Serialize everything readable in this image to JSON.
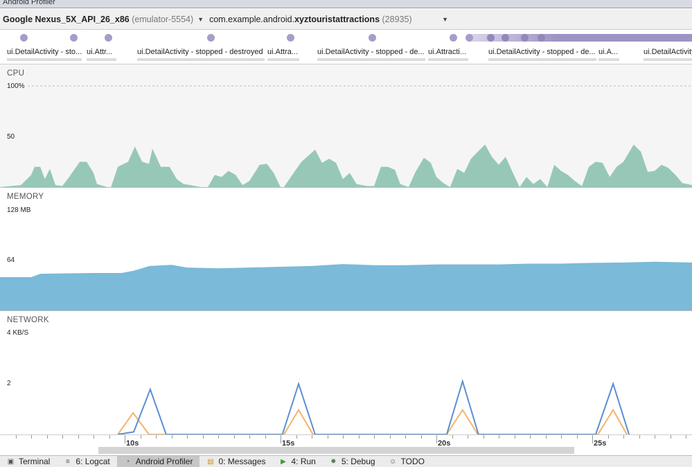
{
  "window_title": "Android Profiler",
  "toolbar": {
    "device_name": "Google Nexus_5X_API_26_x86",
    "device_id": "(emulator-5554)",
    "process_prefix": "com.example.android.",
    "process_name": "xyztouristattractions",
    "pid": "(28935)"
  },
  "events": {
    "labels": [
      "ui.DetailActivity - sto...",
      "ui.Attr...",
      "ui.DetailActivity - stopped - destroyed",
      "ui.Attra...",
      "ui.DetailActivity - stopped - de...",
      "ui.Attracti...",
      "ui.DetailActivity - stopped - de...",
      "ui.A...",
      "ui.DetailActivity"
    ]
  },
  "cpu": {
    "label": "CPU",
    "tick_max": "100%",
    "tick_mid": "50",
    "color": "#97c8b7"
  },
  "memory": {
    "label": "MEMORY",
    "tick_max": "128 MB",
    "tick_mid": "64",
    "color": "#7bbad8"
  },
  "network": {
    "label": "NETWORK",
    "tick_max": "4 KB/S",
    "tick_mid": "2",
    "received_color": "#5b8fcf",
    "sent_color": "#f3b46b"
  },
  "time_axis": {
    "labels": [
      "10s",
      "15s",
      "20s",
      "25s"
    ]
  },
  "bottom_tabs": [
    {
      "label": "Terminal",
      "icon": "terminal-icon"
    },
    {
      "label": "6: Logcat",
      "icon": "logcat-icon"
    },
    {
      "label": "Android Profiler",
      "icon": "profiler-icon",
      "active": true
    },
    {
      "label": "0: Messages",
      "icon": "messages-icon"
    },
    {
      "label": "4: Run",
      "icon": "run-icon"
    },
    {
      "label": "5: Debug",
      "icon": "debug-icon"
    },
    {
      "label": "TODO",
      "icon": "todo-icon"
    }
  ],
  "chart_data": [
    {
      "type": "area",
      "title": "CPU",
      "ylabel": "%",
      "ylim": [
        0,
        100
      ],
      "xunit": "s",
      "x": [
        6,
        6.67,
        7,
        7.11,
        7.29,
        7.44,
        7.6,
        7.78,
        8,
        8.22,
        8.56,
        8.78,
        9,
        9.11,
        9.44,
        9.56,
        9.78,
        10.11,
        10.33,
        10.56,
        10.78,
        10.89,
        11.16,
        11.44,
        11.67,
        11.89,
        12.11,
        12.44,
        12.67,
        12.89,
        13.11,
        13.33,
        13.56,
        13.78,
        14,
        14.33,
        14.56,
        14.78,
        15,
        15.11,
        15.33,
        15.67,
        15.89,
        16.11,
        16.33,
        16.56,
        16.78,
        17,
        17.22,
        17.44,
        17.78,
        18,
        18.22,
        18.44,
        18.67,
        18.84,
        19.11,
        19.33,
        19.6,
        19.82,
        20,
        20.22,
        20.44,
        20.67,
        20.89,
        21.11,
        21.33,
        21.56,
        21.78,
        22,
        22.22,
        22.44,
        22.67,
        22.89,
        23.11,
        23.33,
        23.56,
        23.78,
        24,
        24.22,
        24.44,
        24.67,
        24.89,
        25.11,
        25.33,
        25.56,
        25.78,
        26,
        26.33,
        26.56,
        26.78,
        27,
        27.22,
        27.44,
        27.67,
        27.89,
        28.2
      ],
      "values": [
        0,
        2,
        12,
        20,
        20,
        8,
        18,
        2,
        1,
        10,
        25,
        25,
        14,
        3,
        0,
        0,
        20,
        25,
        40,
        25,
        23,
        38,
        20,
        20,
        8,
        3,
        2,
        0,
        0,
        12,
        10,
        16,
        12,
        2,
        6,
        22,
        23,
        14,
        0,
        0,
        10,
        25,
        31,
        37,
        24,
        28,
        24,
        8,
        14,
        3,
        1,
        1,
        20,
        20,
        17,
        3,
        0,
        15,
        29,
        24,
        10,
        4,
        0,
        18,
        14,
        28,
        35,
        42,
        30,
        22,
        30,
        15,
        0,
        10,
        3,
        8,
        0,
        22,
        16,
        12,
        6,
        1,
        20,
        25,
        24,
        10,
        20,
        25,
        42,
        35,
        15,
        16,
        22,
        19,
        12,
        4,
        2
      ]
    },
    {
      "type": "area",
      "title": "MEMORY",
      "ylabel": "MB",
      "ylim": [
        0,
        128
      ],
      "x": [
        6,
        7,
        7.3,
        8,
        9,
        9.9,
        10.3,
        10.8,
        11.5,
        12,
        13,
        14,
        15,
        16,
        17,
        18,
        19,
        20,
        21,
        22,
        23,
        24,
        25,
        26,
        27,
        28.2
      ],
      "values": [
        42.7,
        42.7,
        47,
        47.5,
        48,
        48,
        51,
        57,
        58.5,
        55,
        54,
        55,
        56,
        57,
        59.5,
        58,
        58,
        59,
        59,
        59,
        60,
        60,
        61,
        61.5,
        62.5,
        61.5
      ]
    },
    {
      "type": "line",
      "title": "NETWORK",
      "ylabel": "KB/S",
      "ylim": [
        0,
        4
      ],
      "series": [
        {
          "x": [
            9.78,
            10.29,
            10.82,
            11.33,
            15.06,
            15.58,
            16.11,
            20.33,
            20.84,
            21.35,
            25.11,
            25.67,
            26.18
          ],
          "values": [
            0,
            0.1,
            1.78,
            0,
            0,
            2.0,
            0,
            0,
            2.1,
            0,
            0,
            2.0,
            0
          ]
        },
        {
          "x": [
            9.78,
            10.27,
            10.78,
            15.11,
            15.58,
            16.04,
            20.33,
            20.84,
            21.33,
            25.18,
            25.67,
            26.11
          ],
          "values": [
            0,
            0.85,
            0,
            0,
            0.97,
            0,
            0,
            0.97,
            0,
            0,
            0.97,
            0
          ]
        }
      ]
    }
  ]
}
